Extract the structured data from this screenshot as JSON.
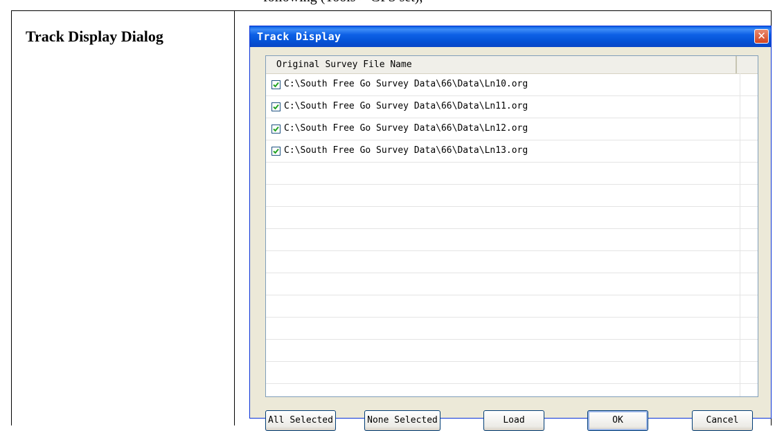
{
  "document": {
    "top_text": "following (Tools > GPS set),",
    "row_label": "Track Display Dialog"
  },
  "dialog": {
    "title": "Track Display",
    "close_glyph": "✕",
    "list": {
      "column_header": "Original Survey File Name",
      "items": [
        {
          "checked": true,
          "name": "C:\\South Free Go Survey Data\\66\\Data\\Ln10.org"
        },
        {
          "checked": true,
          "name": "C:\\South Free Go Survey Data\\66\\Data\\Ln11.org"
        },
        {
          "checked": true,
          "name": "C:\\South Free Go Survey Data\\66\\Data\\Ln12.org"
        },
        {
          "checked": true,
          "name": "C:\\South Free Go Survey Data\\66\\Data\\Ln13.org"
        }
      ]
    },
    "buttons": {
      "all_selected": "All Selected",
      "none_selected": "None Selected",
      "load": "Load",
      "ok": "OK",
      "cancel": "Cancel"
    }
  },
  "colors": {
    "title_bar": "#0553D7",
    "dialog_bg": "#ECE9D8",
    "close_button": "#D4441F",
    "checkbox_check": "#21A121"
  },
  "icons": {
    "close": "close-icon",
    "checkbox": "checkmark-icon"
  }
}
